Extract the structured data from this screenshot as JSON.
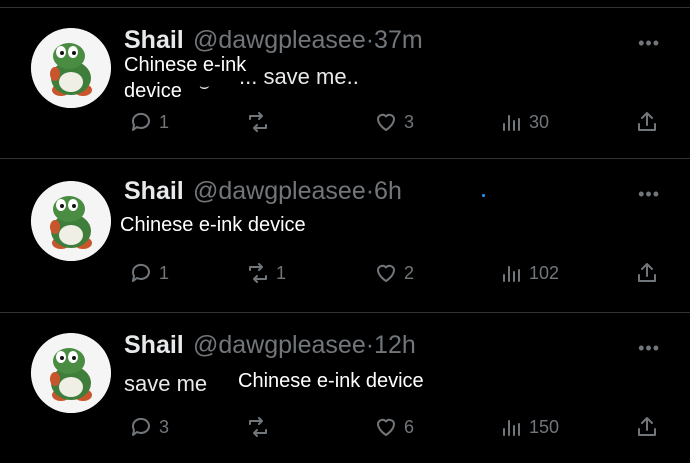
{
  "tweets": [
    {
      "name": "Shail",
      "handle": "@dawgpleasee",
      "dot": "·",
      "time": "37m",
      "more": "•••",
      "text": "... save me..",
      "overlay_line1": "Chinese e-ink",
      "overlay_line2": "device",
      "overlay_tail": "⌣",
      "replies": "1",
      "reposts": "",
      "likes": "3",
      "views": "30"
    },
    {
      "name": "Shail",
      "handle": "@dawgpleasee",
      "dot": "·",
      "time": "6h",
      "more": "•••",
      "text": "",
      "overlay": "Chinese e-ink device",
      "replies": "1",
      "reposts": "1",
      "likes": "2",
      "views": "102"
    },
    {
      "name": "Shail",
      "handle": "@dawgpleasee",
      "dot": "·",
      "time": "12h",
      "more": "•••",
      "text": "save me",
      "overlay": "Chinese e-ink device",
      "replies": "3",
      "reposts": "",
      "likes": "6",
      "views": "150"
    }
  ],
  "colors": {
    "background": "#000000",
    "text": "#e7e9ea",
    "muted": "#71767b",
    "separator": "#2f3336"
  }
}
